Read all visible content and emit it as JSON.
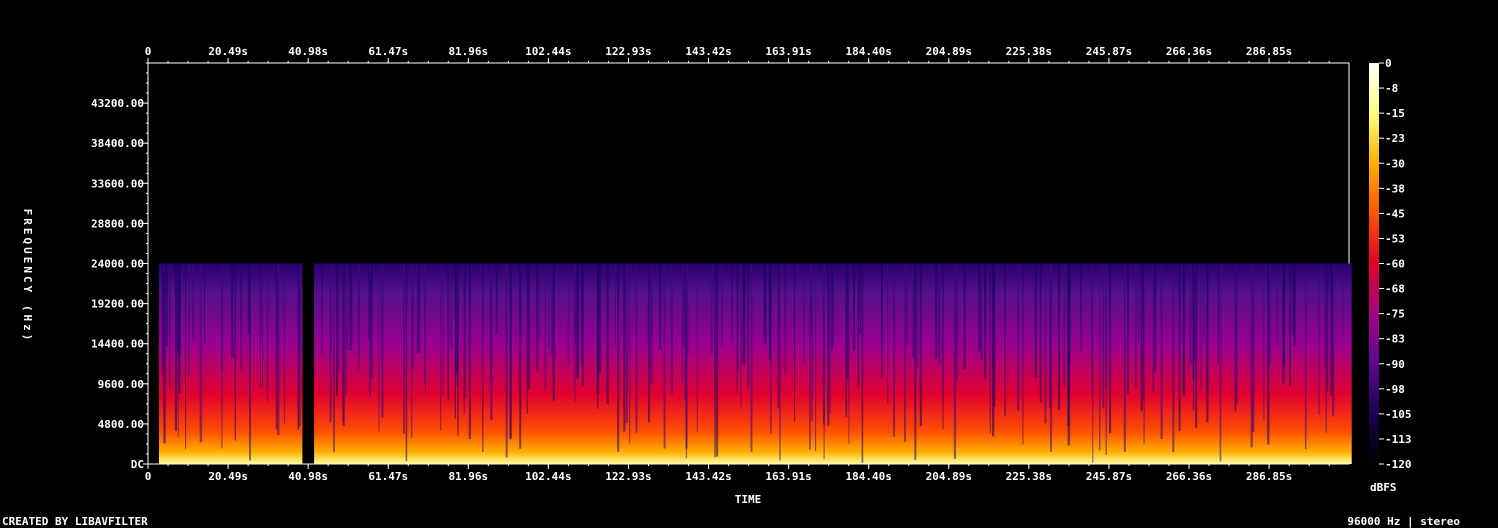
{
  "chart_data": {
    "type": "heatmap",
    "title": "",
    "xlabel": "TIME",
    "ylabel": "FREQUENCY (Hz)",
    "x_ticks": [
      "0",
      "20.49s",
      "40.98s",
      "61.47s",
      "81.96s",
      "102.44s",
      "122.93s",
      "143.42s",
      "163.91s",
      "184.40s",
      "204.89s",
      "225.38s",
      "245.87s",
      "266.36s",
      "286.85s"
    ],
    "x_tick_values_s": [
      0,
      20.49,
      40.98,
      61.47,
      81.96,
      102.44,
      122.93,
      143.42,
      163.91,
      184.4,
      204.89,
      225.38,
      245.87,
      266.36,
      286.85
    ],
    "xlim_s": [
      0,
      307.3
    ],
    "y_ticks": [
      "DC",
      "4800.00",
      "9600.00",
      "14400.00",
      "19200.00",
      "24000.00",
      "28800.00",
      "33600.00",
      "38400.00",
      "43200.00"
    ],
    "y_tick_values_hz": [
      0,
      4800,
      9600,
      14400,
      19200,
      24000,
      28800,
      33600,
      38400,
      43200
    ],
    "ylim_hz": [
      0,
      48000
    ],
    "content_band_hz": [
      0,
      24000
    ],
    "colorbar": {
      "label": "dBFS",
      "ticks": [
        "0",
        "-8",
        "-15",
        "-23",
        "-30",
        "-38",
        "-45",
        "-53",
        "-60",
        "-68",
        "-75",
        "-83",
        "-90",
        "-98",
        "-105",
        "-113",
        "-120"
      ],
      "range_db": [
        -120,
        0
      ],
      "colors": [
        "#000000",
        "#1a0050",
        "#5a0a8f",
        "#a00080",
        "#e0002a",
        "#ff5500",
        "#ffb000",
        "#ffff80",
        "#ffffff"
      ]
    },
    "silent_segments_s": [
      [
        0,
        2.8
      ],
      [
        39.5,
        42.5
      ],
      [
        308,
        309
      ]
    ]
  },
  "footer": {
    "credit": "CREATED BY LIBAVFILTER",
    "info": "96000 Hz | stereo"
  }
}
